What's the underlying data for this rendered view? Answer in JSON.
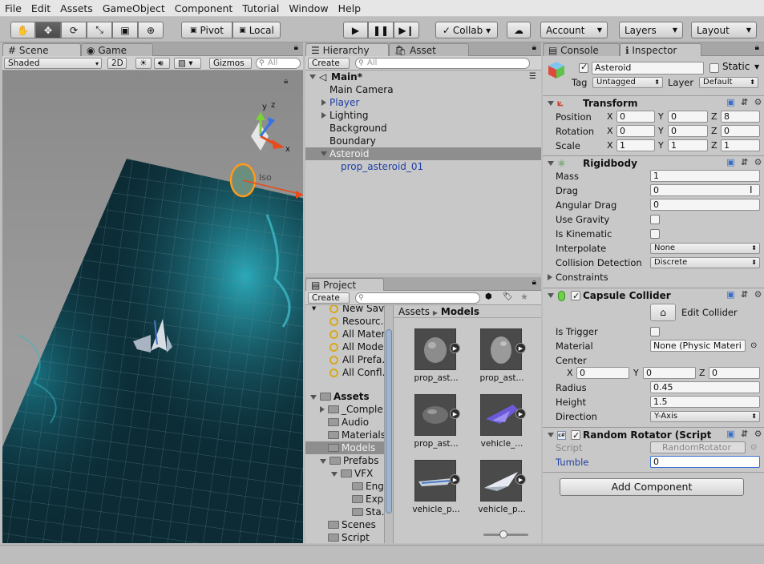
{
  "menu": [
    "File",
    "Edit",
    "Assets",
    "GameObject",
    "Component",
    "Tutorial",
    "Window",
    "Help"
  ],
  "toolbar": {
    "pivot": "Pivot",
    "local": "Local",
    "collab": "Collab ▾",
    "account": "Account",
    "layers": "Layers",
    "layout": "Layout"
  },
  "scene": {
    "tab_scene": "Scene",
    "tab_game": "Game",
    "shading": "Shaded",
    "mode2d": "2D",
    "gizmos": "Gizmos ▾",
    "search": "All",
    "gizmo_y": "y",
    "gizmo_z": "z",
    "gizmo_x": "x",
    "iso": "Iso"
  },
  "hierarchy": {
    "tab": "Hierarchy",
    "tab2": "Asset Store",
    "create": "Create ▾",
    "search": "All",
    "scene_name": "Main*",
    "items": [
      "Main Camera",
      "Player",
      "Lighting",
      "Background",
      "Boundary",
      "Asteroid",
      "prop_asteroid_01"
    ]
  },
  "project": {
    "tab": "Project",
    "create": "Create ▾",
    "tree": [
      "New Sav...",
      "Resourc...",
      "All Materi...",
      "All Mode...",
      "All Prefa...",
      "All Confl...",
      "Assets",
      "_Comple...",
      "Audio",
      "Materials",
      "Models",
      "Prefabs",
      "VFX",
      "Engi...",
      "Exp...",
      "Sta...",
      "Scenes",
      "Script"
    ],
    "breadcrumb_root": "Assets",
    "breadcrumb_leaf": "Models",
    "thumbs": [
      "prop_ast...",
      "prop_ast...",
      "prop_ast...",
      "vehicle_...",
      "vehicle_p...",
      "vehicle_p..."
    ]
  },
  "inspector": {
    "tab_console": "Console",
    "tab_inspector": "Inspector",
    "object_name": "Asteroid",
    "static": "Static",
    "tag_label": "Tag",
    "tag_value": "Untagged",
    "layer_label": "Layer",
    "layer_value": "Default",
    "transform": {
      "title": "Transform",
      "position_label": "Position",
      "rotation_label": "Rotation",
      "scale_label": "Scale",
      "position": [
        "0",
        "0",
        "8"
      ],
      "rotation": [
        "0",
        "0",
        "0"
      ],
      "scale": [
        "1",
        "1",
        "1"
      ],
      "x": "X",
      "y": "Y",
      "z": "Z"
    },
    "rigidbody": {
      "title": "Rigidbody",
      "mass_label": "Mass",
      "mass": "1",
      "drag_label": "Drag",
      "drag": "0",
      "angular_label": "Angular Drag",
      "angular": "0",
      "gravity_label": "Use Gravity",
      "kinematic_label": "Is Kinematic",
      "interpolate_label": "Interpolate",
      "interpolate": "None",
      "collision_label": "Collision Detection",
      "collision": "Discrete",
      "constraints_label": "Constraints"
    },
    "capsule": {
      "title": "Capsule Collider",
      "edit_collider": "Edit Collider",
      "trigger_label": "Is Trigger",
      "material_label": "Material",
      "material": "None (Physic Materi",
      "center_label": "Center",
      "center": [
        "0",
        "0",
        "0"
      ],
      "radius_label": "Radius",
      "radius": "0.45",
      "height_label": "Height",
      "height": "1.5",
      "direction_label": "Direction",
      "direction": "Y-Axis"
    },
    "rotator": {
      "title": "Random Rotator (Script",
      "script_label": "Script",
      "script_value": "RandomRotator",
      "tumble_label": "Tumble",
      "tumble": "0"
    },
    "add_component": "Add Component"
  }
}
